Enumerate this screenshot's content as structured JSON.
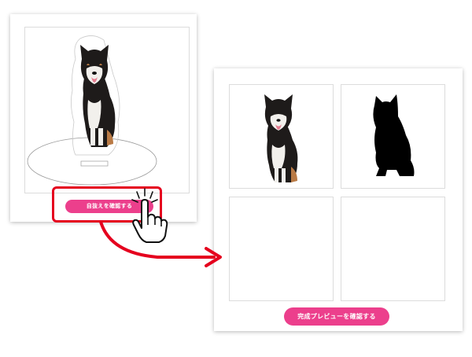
{
  "left_panel": {
    "check_cutout_button_label": "自抜えを確認する"
  },
  "right_panel": {
    "final_preview_button_label": "完成プレビューを確認する"
  },
  "colors": {
    "accent_pink": "#ec3f8c",
    "highlight_red": "#e5001e",
    "dog_black": "#1e1b1a",
    "dog_tan": "#b97a45",
    "silhouette": "#000000"
  },
  "icons": [
    "pointing-hand-icon",
    "arrow-icon"
  ]
}
